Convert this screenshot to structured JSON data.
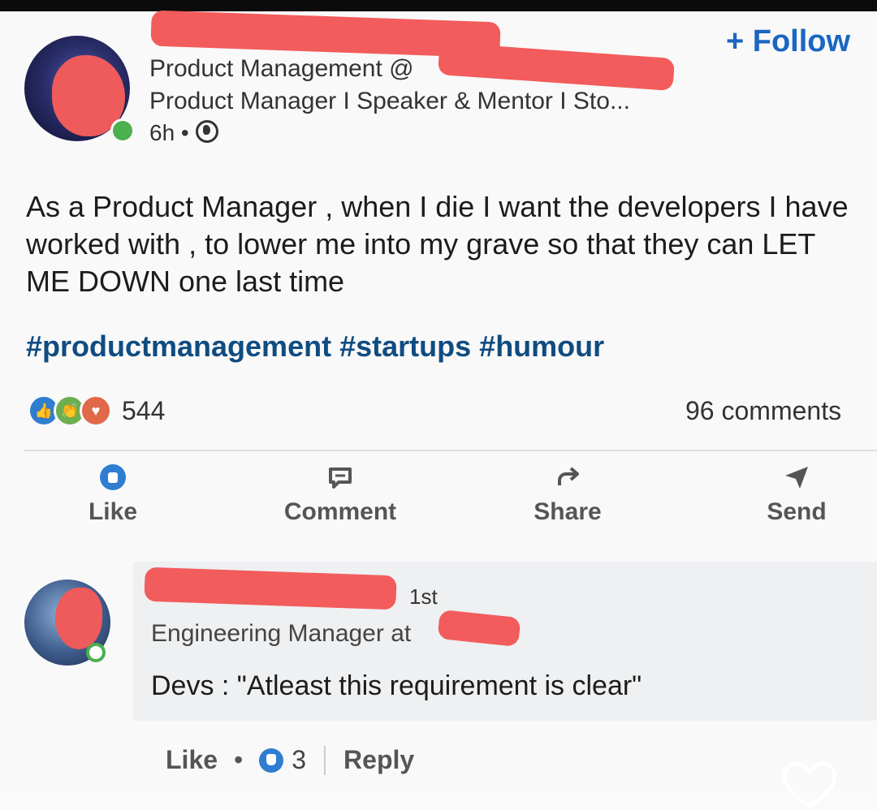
{
  "post": {
    "follow_label": "+ Follow",
    "author_headline_1": "Product Management @",
    "author_headline_2": "Product Manager I Speaker & Mentor I Sto...",
    "time_ago": "6h •",
    "body": "As a Product Manager , when I die I want the developers I have worked with , to lower me into my grave so that they can LET ME DOWN one last time",
    "hashtags": [
      "#productmanagement",
      "#startups",
      "#humour"
    ],
    "reaction_count": "544",
    "comments_count": "96 comments",
    "actions": {
      "like": "Like",
      "comment": "Comment",
      "share": "Share",
      "send": "Send"
    }
  },
  "comment": {
    "degree": "1st",
    "title": "Engineering Manager at",
    "text": "Devs : \"Atleast this requirement is clear\"",
    "like_label": "Like",
    "like_count": "3",
    "reply_label": "Reply"
  },
  "colors": {
    "accent_blue": "#1a66c2",
    "hashtag": "#0f4c81",
    "redaction": "#f25c5c",
    "online": "#4caf50"
  },
  "icons": [
    "globe-icon",
    "like-icon",
    "comment-icon",
    "share-icon",
    "send-icon",
    "heart-icon"
  ]
}
